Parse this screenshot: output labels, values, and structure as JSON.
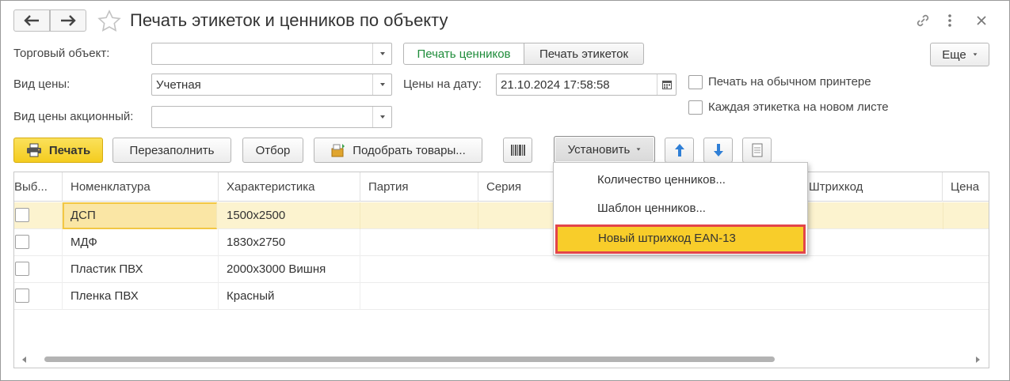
{
  "window": {
    "title": "Печать этикеток и ценников по объекту"
  },
  "form": {
    "trade_object_label": "Торговый объект:",
    "trade_object_value": "",
    "price_type_label": "Вид цены:",
    "price_type_value": "Учетная",
    "promo_price_type_label": "Вид цены акционный:",
    "promo_price_type_value": "",
    "prices_date_label": "Цены на дату:",
    "prices_date_value": "21.10.2024 17:58:58",
    "mode_tabs": [
      "Печать ценников",
      "Печать этикеток"
    ],
    "more_label": "Еще",
    "checkbox_regular_printer": "Печать на обычном принтере",
    "checkbox_each_new_sheet": "Каждая этикетка на новом листе"
  },
  "toolbar": {
    "print_label": "Печать",
    "refill_label": "Перезаполнить",
    "filter_label": "Отбор",
    "pick_goods_label": "Подобрать товары...",
    "set_label": "Установить"
  },
  "table": {
    "columns": [
      "Выб...",
      "Номенклатура",
      "Характеристика",
      "Партия",
      "Серия",
      "",
      "Штрихкод",
      "Цена"
    ],
    "rows": [
      {
        "item": "ДСП",
        "characteristic": "1500x2500"
      },
      {
        "item": "МДФ",
        "characteristic": "1830x2750"
      },
      {
        "item": "Пластик ПВХ",
        "characteristic": "2000x3000 Вишня"
      },
      {
        "item": "Пленка ПВХ",
        "characteristic": "Красный"
      }
    ]
  },
  "set_menu": {
    "items": [
      "Количество ценников...",
      "Шаблон ценников...",
      "Новый штрихкод EAN-13"
    ]
  },
  "colors": {
    "accent_green": "#1e8c3a",
    "print_button": "#f7d530",
    "selected_row": "#fcf3cf",
    "menu_highlight": "#f8cd2a",
    "menu_highlight_border": "#e2454a",
    "arrow_blue": "#2f7fd6"
  }
}
